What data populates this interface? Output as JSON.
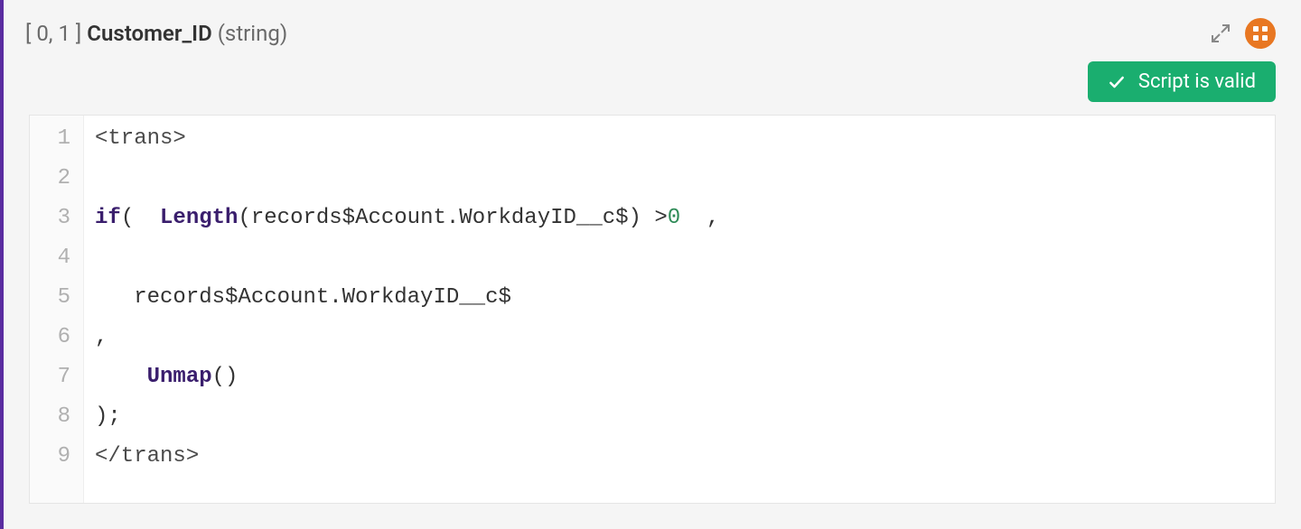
{
  "header": {
    "cardinality": "[ 0, 1 ]",
    "field_name": "Customer_ID",
    "field_type": "(string)"
  },
  "actions": {
    "expand_name": "expand-icon",
    "grid_name": "grid-icon"
  },
  "status": {
    "label": "Script is valid"
  },
  "code": {
    "lines": [
      {
        "n": 1,
        "segments": [
          {
            "cls": "tok-tag",
            "text": "<trans>"
          }
        ]
      },
      {
        "n": 2,
        "segments": []
      },
      {
        "n": 3,
        "segments": [
          {
            "cls": "tok-kw",
            "text": "if"
          },
          {
            "cls": "tok-punc",
            "text": "( "
          },
          {
            "cls": "tok-fn",
            "text": " Length"
          },
          {
            "cls": "tok-punc",
            "text": "(records$Account.WorkdayID__c$) >"
          },
          {
            "cls": "tok-num",
            "text": "0"
          },
          {
            "cls": "tok-punc",
            "text": "  ,"
          }
        ]
      },
      {
        "n": 4,
        "segments": []
      },
      {
        "n": 5,
        "segments": [
          {
            "cls": "tok-punc",
            "text": "   records$Account.WorkdayID__c$"
          }
        ]
      },
      {
        "n": 6,
        "segments": [
          {
            "cls": "tok-punc",
            "text": ","
          }
        ]
      },
      {
        "n": 7,
        "segments": [
          {
            "cls": "tok-punc",
            "text": "    "
          },
          {
            "cls": "tok-fn",
            "text": "Unmap"
          },
          {
            "cls": "tok-punc",
            "text": "()"
          }
        ]
      },
      {
        "n": 8,
        "segments": [
          {
            "cls": "tok-punc",
            "text": ");"
          }
        ]
      },
      {
        "n": 9,
        "segments": [
          {
            "cls": "tok-tag",
            "text": "</trans>"
          }
        ]
      }
    ]
  }
}
